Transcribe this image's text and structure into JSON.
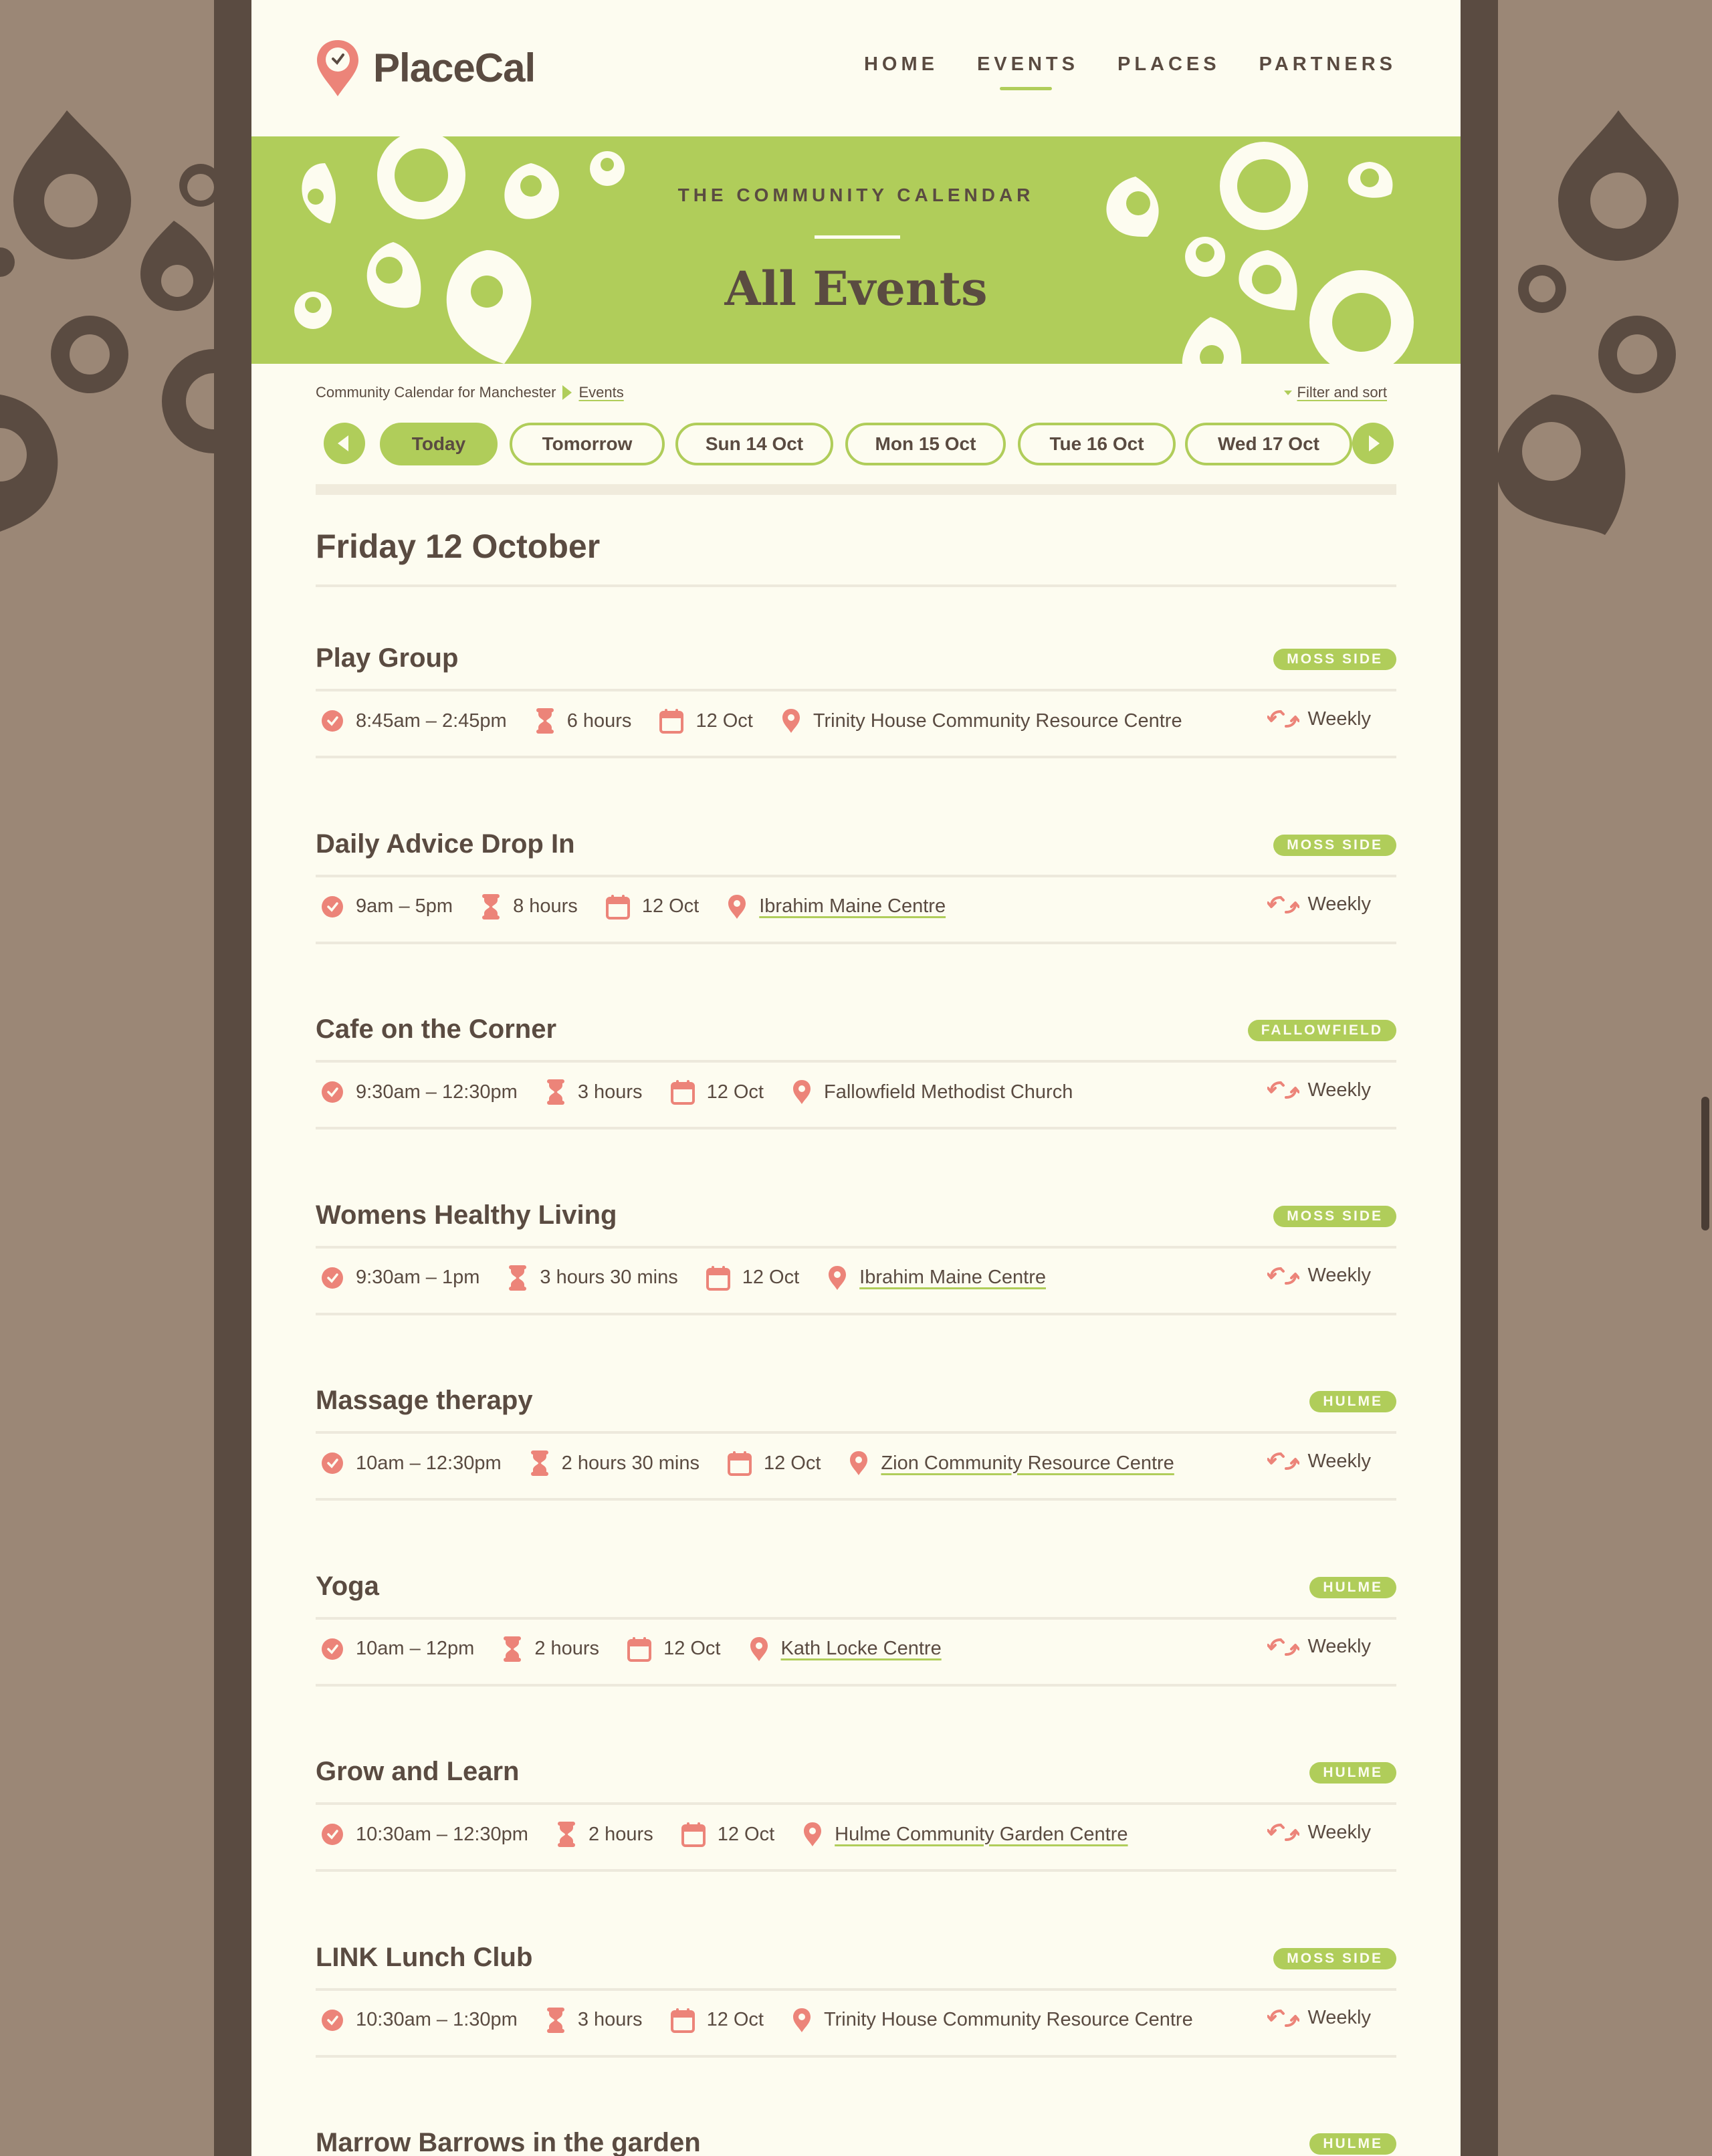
{
  "colors": {
    "accent_green": "#b0cd5a",
    "coral": "#ec8479",
    "dark_brown": "#5a4b41",
    "page_bg": "#fdfcf0",
    "outer_bg": "#9b8776"
  },
  "brand": {
    "name": "PlaceCal",
    "logo_icon": "map-pin-clock-icon"
  },
  "nav": {
    "items": [
      "HOME",
      "EVENTS",
      "PLACES",
      "PARTNERS"
    ],
    "active": "EVENTS"
  },
  "hero": {
    "kicker": "THE COMMUNITY CALENDAR",
    "title": "All Events"
  },
  "breadcrumb": {
    "root": "Community Calendar for Manchester",
    "current": "Events"
  },
  "filter": {
    "label": "Filter and sort"
  },
  "datebar": {
    "prev_icon": "chevron-left-icon",
    "next_icon": "chevron-right-icon",
    "pills": [
      "Today",
      "Tomorrow",
      "Sun 14 Oct",
      "Mon 15 Oct",
      "Tue 16 Oct",
      "Wed 17 Oct"
    ],
    "active": "Today"
  },
  "day": {
    "heading": "Friday 12 October"
  },
  "events": [
    {
      "title": "Play Group",
      "area": "MOSS SIDE",
      "time": "8:45am – 2:45pm",
      "duration": "6 hours",
      "date": "12 Oct",
      "location": "Trinity House Community Resource Centre",
      "location_linked": false,
      "repeat": "Weekly"
    },
    {
      "title": "Daily Advice Drop In",
      "area": "MOSS SIDE",
      "time": "9am – 5pm",
      "duration": "8 hours",
      "date": "12 Oct",
      "location": "Ibrahim Maine Centre",
      "location_linked": true,
      "repeat": "Weekly"
    },
    {
      "title": "Cafe on the Corner",
      "area": "FALLOWFIELD",
      "time": "9:30am – 12:30pm",
      "duration": "3 hours",
      "date": "12 Oct",
      "location": "Fallowfield Methodist Church",
      "location_linked": false,
      "repeat": "Weekly"
    },
    {
      "title": "Womens Healthy Living",
      "area": "MOSS SIDE",
      "time": "9:30am – 1pm",
      "duration": "3 hours 30 mins",
      "date": "12 Oct",
      "location": "Ibrahim Maine Centre",
      "location_linked": true,
      "repeat": "Weekly"
    },
    {
      "title": "Massage therapy",
      "area": "HULME",
      "time": "10am – 12:30pm",
      "duration": "2 hours 30 mins",
      "date": "12 Oct",
      "location": "Zion Community Resource Centre",
      "location_linked": true,
      "repeat": "Weekly"
    },
    {
      "title": "Yoga",
      "area": "HULME",
      "time": "10am – 12pm",
      "duration": "2 hours",
      "date": "12 Oct",
      "location": "Kath Locke Centre",
      "location_linked": true,
      "repeat": "Weekly"
    },
    {
      "title": "Grow and Learn",
      "area": "HULME",
      "time": "10:30am – 12:30pm",
      "duration": "2 hours",
      "date": "12 Oct",
      "location": "Hulme Community Garden Centre",
      "location_linked": true,
      "repeat": "Weekly"
    },
    {
      "title": "LINK Lunch Club",
      "area": "MOSS SIDE",
      "time": "10:30am – 1:30pm",
      "duration": "3 hours",
      "date": "12 Oct",
      "location": "Trinity House Community Resource Centre",
      "location_linked": false,
      "repeat": "Weekly"
    },
    {
      "title": "Marrow Barrows in the garden",
      "area": "HULME"
    }
  ]
}
